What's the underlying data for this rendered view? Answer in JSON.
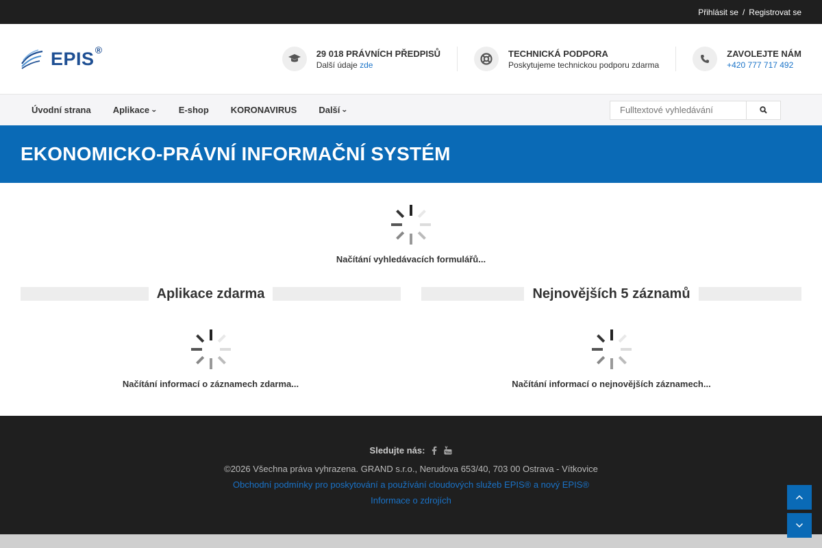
{
  "topbar": {
    "login": "Přihlásit se",
    "separator": "/",
    "register": "Registrovat se"
  },
  "logo": {
    "text": "EPIS",
    "mark": "®"
  },
  "header": {
    "blocks": [
      {
        "icon": "graduation-cap-icon",
        "title": "29 018 PRÁVNÍCH PŘEDPISŮ",
        "sub": "Další údaje",
        "link": "zde"
      },
      {
        "icon": "lifebuoy-icon",
        "title": "TECHNICKÁ PODPORA",
        "sub": "Poskytujeme technickou podporu zdarma"
      },
      {
        "icon": "phone-icon",
        "title": "ZAVOLEJTE NÁM",
        "link": "+420 777 717 492"
      }
    ]
  },
  "nav": {
    "items": [
      {
        "label": "Úvodní strana"
      },
      {
        "label": "Aplikace",
        "dropdown": true
      },
      {
        "label": "E-shop"
      },
      {
        "label": "KORONAVIRUS"
      },
      {
        "label": "Další",
        "dropdown": true
      }
    ],
    "search_placeholder": "Fulltextové vyhledávání"
  },
  "banner": {
    "title": "EKONOMICKO-PRÁVNÍ INFORMAČNÍ SYSTÉM"
  },
  "main": {
    "loading_forms": "Načítání vyhledávacích formulářů...",
    "left": {
      "title": "Aplikace zdarma",
      "loading": "Načítání informací o záznamech zdarma..."
    },
    "right": {
      "title": "Nejnovějších 5 záznamů",
      "loading": "Načítání informací o nejnovějších záznamech..."
    }
  },
  "footer": {
    "follow": "Sledujte nás:",
    "copyright": "©2026 Všechna práva vyhrazena. GRAND s.r.o., Nerudova 653/40, 703 00 Ostrava - Vítkovice",
    "terms_link": "Obchodní podmínky pro poskytování a používání cloudových služeb EPIS® a nový EPIS®",
    "sources_link": "Informace o zdrojích"
  },
  "colors": {
    "brand_blue": "#0a6ab6",
    "dark": "#1f1f1f",
    "link": "#1a73c8"
  }
}
